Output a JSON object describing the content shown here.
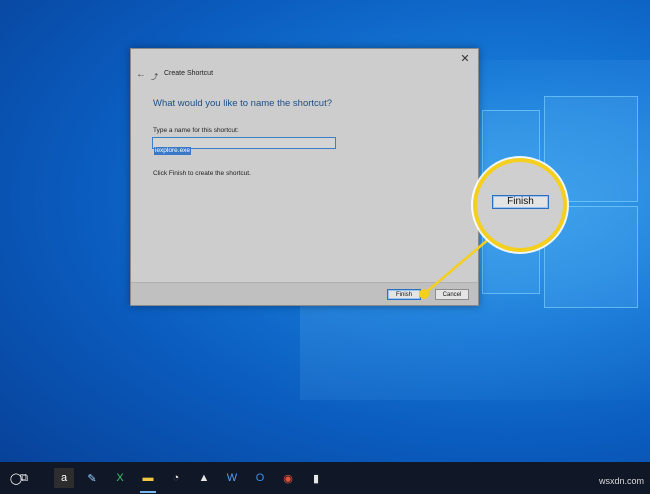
{
  "dialog": {
    "title": "Create Shortcut",
    "heading": "What would you like to name the shortcut?",
    "field_label": "Type a name for this shortcut:",
    "field_value": "iexplore.exe",
    "instruction": "Click Finish to create the shortcut.",
    "finish_label": "Finish",
    "cancel_label": "Cancel",
    "close_glyph": "✕",
    "back_glyph": "←"
  },
  "callout": {
    "label": "Finish",
    "highlight_color": "#f5cf1d"
  },
  "taskbar": {
    "search_glyph": "◯",
    "apps": [
      {
        "name": "task-view-icon",
        "glyph": "⧉"
      },
      {
        "name": "amazon-icon",
        "glyph": "a"
      },
      {
        "name": "notepad-icon",
        "glyph": "✎"
      },
      {
        "name": "excel-icon",
        "glyph": "X"
      },
      {
        "name": "file-explorer-icon",
        "glyph": "▬"
      },
      {
        "name": "app-icon",
        "glyph": "◔"
      },
      {
        "name": "photos-icon",
        "glyph": "▲"
      },
      {
        "name": "word-icon",
        "glyph": "W"
      },
      {
        "name": "outlook-icon",
        "glyph": "O"
      },
      {
        "name": "chrome-icon",
        "glyph": "◉"
      },
      {
        "name": "app-icon-2",
        "glyph": "▮"
      }
    ]
  },
  "watermark": "wsxdn.com",
  "colors": {
    "accent": "#3a78c9",
    "callout": "#f5cf1d",
    "taskbar": "#101828"
  }
}
